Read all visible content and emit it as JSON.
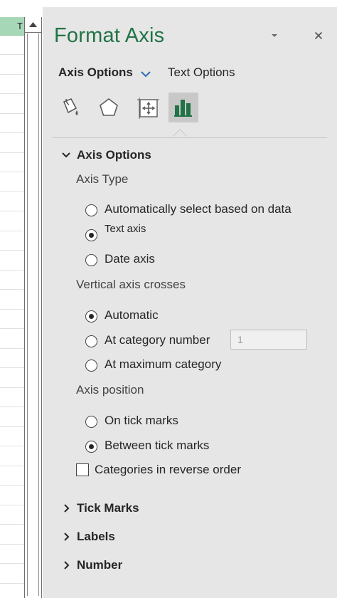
{
  "sheet": {
    "header_cell_text": "T"
  },
  "pane": {
    "title": "Format Axis",
    "accent_color": "#217346",
    "menu_icon": "chevron-down-icon",
    "close_icon": "close-icon"
  },
  "tabs": {
    "axis_options": "Axis Options",
    "text_options": "Text Options"
  },
  "category_icons": [
    {
      "name": "fill-line-icon",
      "selected": false
    },
    {
      "name": "effects-pentagon-icon",
      "selected": false
    },
    {
      "name": "size-properties-icon",
      "selected": false
    },
    {
      "name": "axis-options-chart-icon",
      "selected": true
    }
  ],
  "axis_options_section": {
    "title": "Axis Options",
    "axis_type": {
      "label": "Axis Type",
      "options": [
        {
          "label": "Automatically select based on data",
          "selected": false
        },
        {
          "label": "Text axis",
          "selected": true
        },
        {
          "label": "Date axis",
          "selected": false
        }
      ]
    },
    "vertical_axis_crosses": {
      "label": "Vertical axis crosses",
      "options": [
        {
          "label": "Automatic",
          "selected": true
        },
        {
          "label": "At category number",
          "selected": false
        },
        {
          "label": "At maximum category",
          "selected": false
        }
      ],
      "category_number_value": "1"
    },
    "axis_position": {
      "label": "Axis position",
      "options": [
        {
          "label": "On tick marks",
          "selected": false
        },
        {
          "label": "Between tick marks",
          "selected": true
        }
      ]
    },
    "reverse_order": {
      "label": "Categories in reverse order",
      "checked": false
    }
  },
  "collapsed_sections": [
    {
      "title": "Tick Marks"
    },
    {
      "title": "Labels"
    },
    {
      "title": "Number"
    }
  ]
}
